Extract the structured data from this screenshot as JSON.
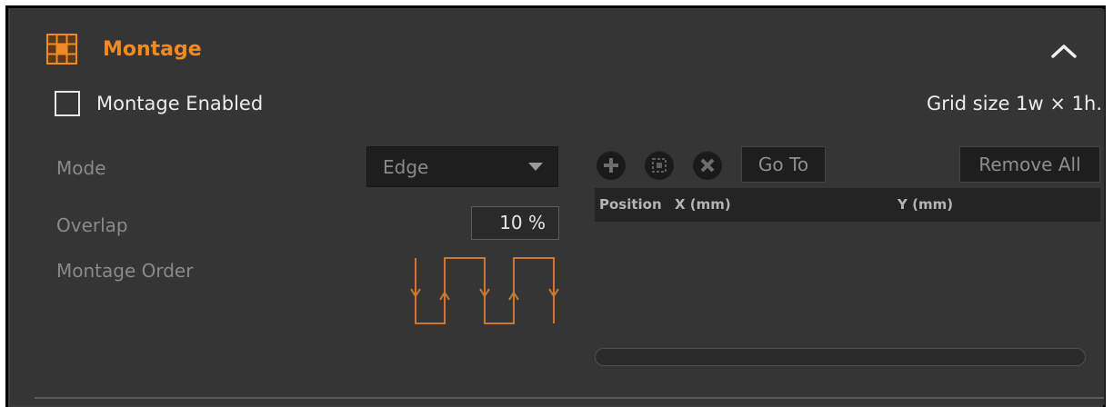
{
  "section": {
    "title": "Montage",
    "icon": "montage-grid-icon",
    "collapse_icon": "chevron-up-icon",
    "accent_color": "#f08a24"
  },
  "montage_enabled": {
    "label": "Montage Enabled",
    "checked": false
  },
  "grid_size": "Grid size 1w × 1h.",
  "settings": {
    "mode": {
      "label": "Mode",
      "value": "Edge"
    },
    "overlap": {
      "label": "Overlap",
      "value": "10 %"
    },
    "order": {
      "label": "Montage Order",
      "icon": "serpentine-order-icon"
    }
  },
  "toolbar": {
    "add_icon": "plus-circle-icon",
    "capture_icon": "position-capture-icon",
    "delete_icon": "x-circle-icon",
    "goto_label": "Go To",
    "remove_all_label": "Remove All"
  },
  "positions_table": {
    "columns": [
      "Position",
      "X (mm)",
      "Y (mm)"
    ],
    "rows": []
  }
}
